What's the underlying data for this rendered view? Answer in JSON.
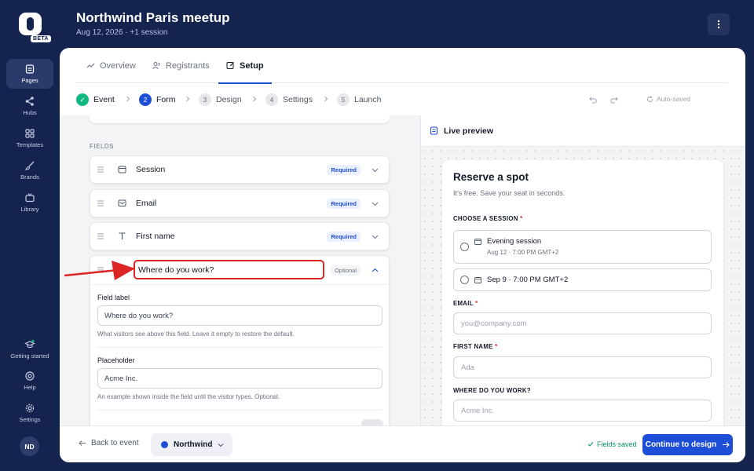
{
  "rail": {
    "beta": "BETA",
    "items": [
      {
        "label": "Pages",
        "icon": "pages-icon"
      },
      {
        "label": "Hubs",
        "icon": "share-icon"
      },
      {
        "label": "Templates",
        "icon": "grid-icon"
      },
      {
        "label": "Brands",
        "icon": "brush-icon"
      },
      {
        "label": "Library",
        "icon": "tv-icon"
      }
    ],
    "bottom_items": [
      {
        "label": "Getting started",
        "icon": "graduation-cap-icon"
      },
      {
        "label": "Help",
        "icon": "lifebuoy-icon"
      },
      {
        "label": "Settings",
        "icon": "gear-icon"
      }
    ],
    "avatar": "ND"
  },
  "header": {
    "title": "Northwind Paris meetup",
    "subtitle": "Aug 12, 2026 · +1 session"
  },
  "tabs": [
    {
      "label": "Overview",
      "icon": "trend-icon"
    },
    {
      "label": "Registrants",
      "icon": "users-icon"
    },
    {
      "label": "Setup",
      "icon": "edit-icon"
    }
  ],
  "steps": [
    {
      "num": "✓",
      "label": "Event",
      "state": "done"
    },
    {
      "num": "2",
      "label": "Form",
      "state": "current"
    },
    {
      "num": "3",
      "label": "Design",
      "state": "todo"
    },
    {
      "num": "4",
      "label": "Settings",
      "state": "todo"
    },
    {
      "num": "5",
      "label": "Launch",
      "state": "todo"
    }
  ],
  "autosaved": "Auto-saved",
  "fields": {
    "section_label": "FIELDS",
    "items": [
      {
        "name": "Session",
        "badge": "Required",
        "icon": "calendar-icon"
      },
      {
        "name": "Email",
        "badge": "Required",
        "icon": "mail-icon"
      },
      {
        "name": "First name",
        "badge": "Required",
        "icon": "text-icon"
      }
    ],
    "expanded": {
      "label_value": "Where do you work?",
      "badge": "Optional",
      "field_label_title": "Field label",
      "field_label_value": "Where do you work?",
      "field_label_help": "What visitors see above this field. Leave it empty to restore the default.",
      "placeholder_title": "Placeholder",
      "placeholder_value": "Acme Inc.",
      "placeholder_help": "An example shown inside the field until the visitor types. Optional."
    }
  },
  "preview": {
    "bar_title": "Live preview",
    "title": "Reserve a spot",
    "subtitle": "It's free. Save your seat in seconds.",
    "session_label": "CHOOSE A SESSION",
    "sessions": [
      {
        "main": "Evening session",
        "time": "Aug 12 · 7:00 PM GMT+2"
      },
      {
        "main": "Sep 9 · 7:00 PM GMT+2",
        "time": ""
      }
    ],
    "email_label": "EMAIL",
    "email_placeholder": "you@company.com",
    "first_name_label": "FIRST NAME",
    "first_name_placeholder": "Ada",
    "work_label": "WHERE DO YOU WORK?",
    "work_placeholder": "Acme Inc.",
    "required_star": "*"
  },
  "footer": {
    "back": "Back to event",
    "brand": "Northwind",
    "saved": "Fields saved",
    "continue": "Continue to design"
  },
  "colors": {
    "background": "#15234f",
    "accent": "#1d4ed8",
    "success": "#10b981",
    "highlight": "#dc2626"
  }
}
